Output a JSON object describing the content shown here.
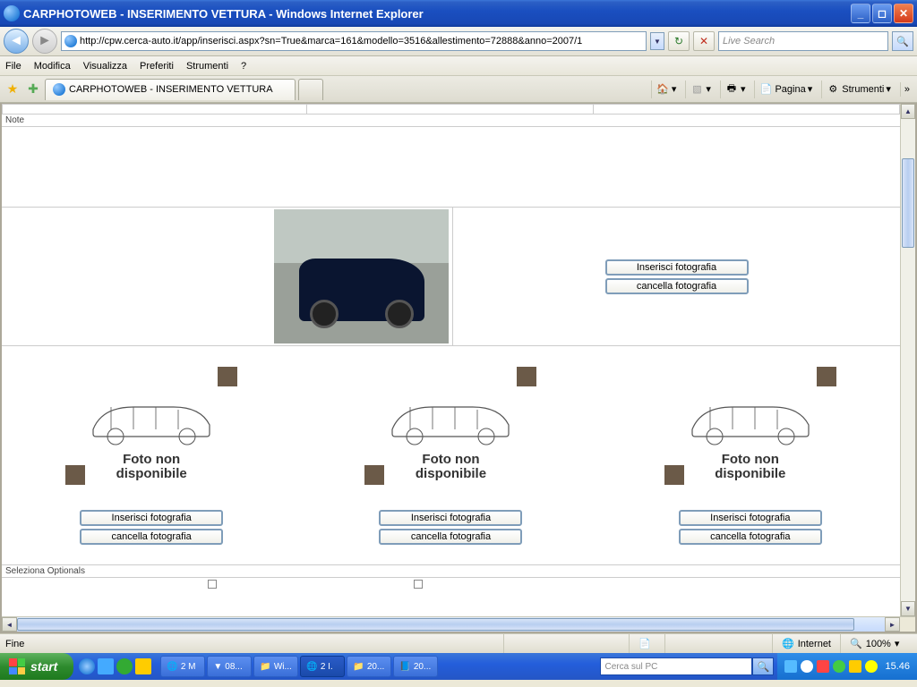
{
  "window": {
    "title": "CARPHOTOWEB - INSERIMENTO VETTURA - Windows Internet Explorer"
  },
  "nav": {
    "url": "http://cpw.cerca-auto.it/app/inserisci.aspx?sn=True&marca=161&modello=3516&allestimento=72888&anno=2007/1",
    "search_placeholder": "Live Search"
  },
  "menu": {
    "file": "File",
    "modifica": "Modifica",
    "visualizza": "Visualizza",
    "preferiti": "Preferiti",
    "strumenti": "Strumenti",
    "help": "?"
  },
  "tab": {
    "title": "CARPHOTOWEB - INSERIMENTO VETTURA"
  },
  "toolbar": {
    "pagina": "Pagina",
    "strumenti": "Strumenti"
  },
  "page": {
    "note_label": "Note",
    "insert_btn": "Inserisci fotografia",
    "delete_btn": "cancella fotografia",
    "placeholder_line1": "Foto non",
    "placeholder_line2": "disponibile",
    "optionals_label": "Seleziona Optionals"
  },
  "status": {
    "left": "Fine",
    "zone": "Internet",
    "zoom": "100%"
  },
  "taskbar": {
    "start": "start",
    "tasks": [
      "2 M",
      "08...",
      "Wi...",
      "2 I.",
      "20...",
      "20..."
    ],
    "search_placeholder": "Cerca sul PC",
    "clock": "15.46"
  }
}
